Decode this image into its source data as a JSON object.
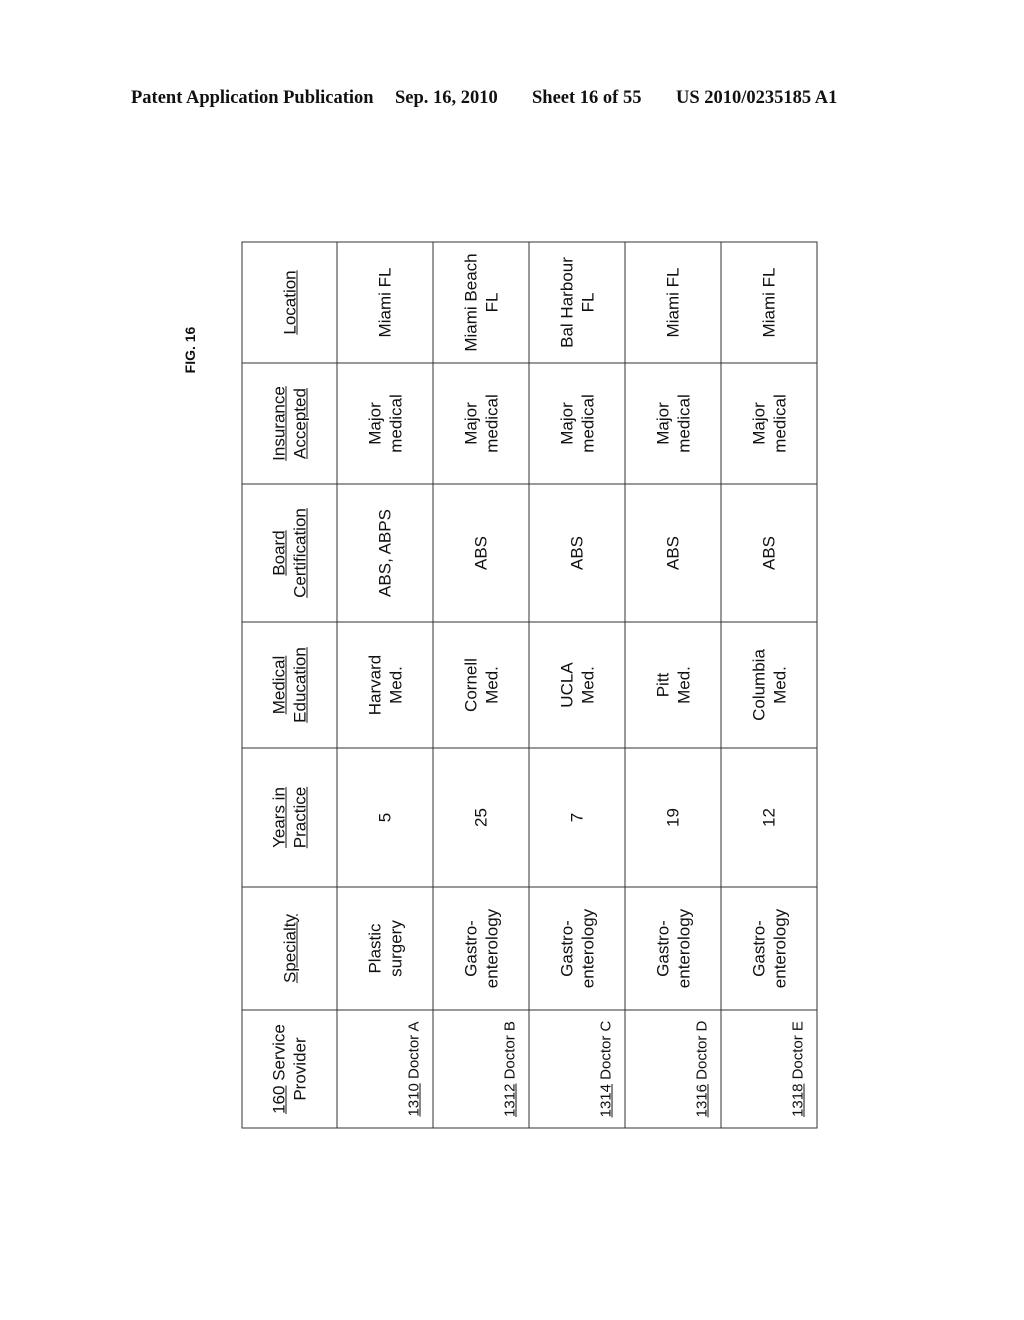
{
  "page_header": {
    "publication": "Patent Application Publication",
    "date": "Sep. 16, 2010",
    "sheet": "Sheet 16 of 55",
    "number": "US 2010/0235185 A1"
  },
  "figure_label": "FIG. 16",
  "table": {
    "headers": {
      "provider_num": "160",
      "provider_label_1": " Service",
      "provider_label_2": "Provider",
      "specialty": "Specialty",
      "years_1": "Years in",
      "years_2": "Practice",
      "education_1": "Medical",
      "education_2": "Education",
      "board_1": "Board",
      "board_2": "Certification",
      "insurance_1": "Insurance",
      "insurance_2": "Accepted",
      "location": "Location"
    },
    "rows": [
      {
        "ref": "1310",
        "name": " Doctor A",
        "specialty_1": "Plastic",
        "specialty_2": "surgery",
        "years": "5",
        "education_1": "Harvard",
        "education_2": "Med.",
        "board": "ABS, ABPS",
        "insurance_1": "Major",
        "insurance_2": "medical",
        "location_1": "Miami FL",
        "location_2": ""
      },
      {
        "ref": "1312",
        "name": " Doctor B",
        "specialty_1": "Gastro-",
        "specialty_2": "enterology",
        "years": "25",
        "education_1": "Cornell",
        "education_2": "Med.",
        "board": "ABS",
        "insurance_1": "Major",
        "insurance_2": "medical",
        "location_1": "Miami Beach",
        "location_2": "FL"
      },
      {
        "ref": "1314",
        "name": " Doctor C",
        "specialty_1": "Gastro-",
        "specialty_2": "enterology",
        "years": "7",
        "education_1": "UCLA",
        "education_2": "Med.",
        "board": "ABS",
        "insurance_1": "Major",
        "insurance_2": "medical",
        "location_1": "Bal Harbour",
        "location_2": "FL"
      },
      {
        "ref": "1316",
        "name": " Doctor D",
        "specialty_1": "Gastro-",
        "specialty_2": "enterology",
        "years": "19",
        "education_1": "Pitt",
        "education_2": "Med.",
        "board": "ABS",
        "insurance_1": "Major",
        "insurance_2": "medical",
        "location_1": "Miami FL",
        "location_2": ""
      },
      {
        "ref": "1318",
        "name": " Doctor E",
        "specialty_1": "Gastro-",
        "specialty_2": "enterology",
        "years": "12",
        "education_1": "Columbia",
        "education_2": "Med.",
        "board": "ABS",
        "insurance_1": "Major",
        "insurance_2": "medical",
        "location_1": "Miami FL",
        "location_2": ""
      }
    ]
  }
}
